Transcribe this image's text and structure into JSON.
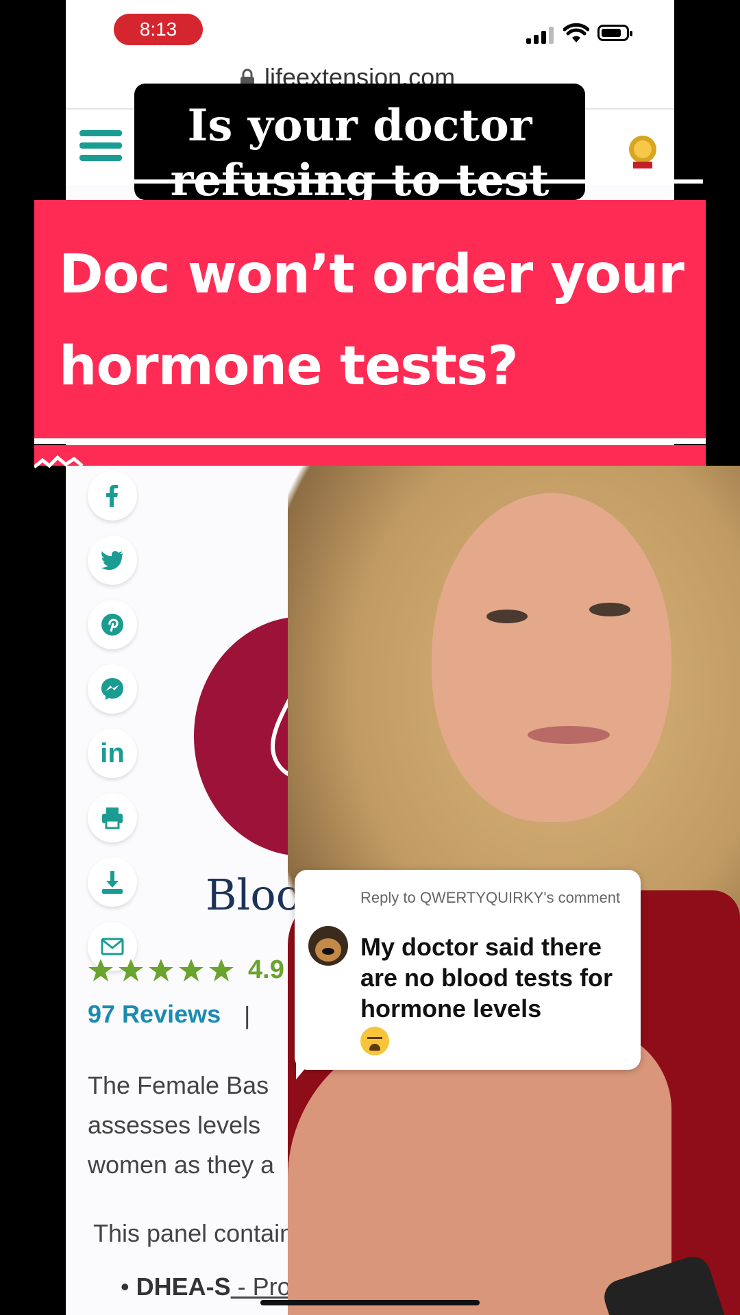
{
  "status_bar": {
    "time": "8:13"
  },
  "browser": {
    "url": "lifeextension.com"
  },
  "headline": {
    "text": "Is your doctor refusing to test"
  },
  "banner": {
    "title": "Doc won’t order your hormone tests?"
  },
  "share_icons": [
    "facebook-icon",
    "twitter-icon",
    "pinterest-icon",
    "messenger-icon",
    "linkedin-icon",
    "print-icon",
    "download-icon",
    "email-icon"
  ],
  "share": {
    "linkedin_label": "in"
  },
  "product": {
    "logo_word": "Bloo",
    "rating": "4.9",
    "stars": 5,
    "reviews_label": "97 Reviews",
    "separator": "|",
    "description": "The Female Bas assesses levels women as they a",
    "panel_intro": "This panel contains t",
    "bullet_name": "DHEA-S",
    "bullet_rest": " - Produced prin"
  },
  "reply": {
    "header": "Reply to QWERTYQUIRKY's comment",
    "body": "My doctor said there are no blood tests for hormone levels"
  },
  "colors": {
    "banner_red": "#fe2c55",
    "teal": "#1a9c93",
    "blood_red": "#9c1238",
    "rating_green": "#6aa32d"
  }
}
